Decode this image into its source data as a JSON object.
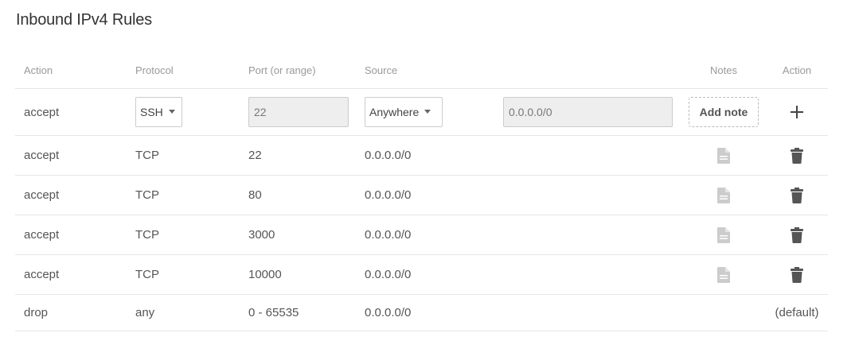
{
  "title": "Inbound IPv4 Rules",
  "headers": {
    "action": "Action",
    "protocol": "Protocol",
    "port": "Port (or range)",
    "source": "Source",
    "notes": "Notes",
    "action2": "Action"
  },
  "new_rule": {
    "action": "accept",
    "protocol": "SSH",
    "port": "22",
    "source": "Anywhere",
    "cidr": "0.0.0.0/0",
    "add_note": "Add note"
  },
  "rules": [
    {
      "action": "accept",
      "protocol": "TCP",
      "port": "22",
      "source": "0.0.0.0/0"
    },
    {
      "action": "accept",
      "protocol": "TCP",
      "port": "80",
      "source": "0.0.0.0/0"
    },
    {
      "action": "accept",
      "protocol": "TCP",
      "port": "3000",
      "source": "0.0.0.0/0"
    },
    {
      "action": "accept",
      "protocol": "TCP",
      "port": "10000",
      "source": "0.0.0.0/0"
    }
  ],
  "default_rule": {
    "action": "drop",
    "protocol": "any",
    "port": "0 - 65535",
    "source": "0.0.0.0/0",
    "label": "(default)"
  },
  "icons": {
    "add": "plus-icon",
    "note": "document-icon",
    "delete": "trash-icon"
  },
  "colors": {
    "icon_dark": "#555555",
    "icon_light": "#cccccc",
    "border": "#e6e6e6"
  }
}
